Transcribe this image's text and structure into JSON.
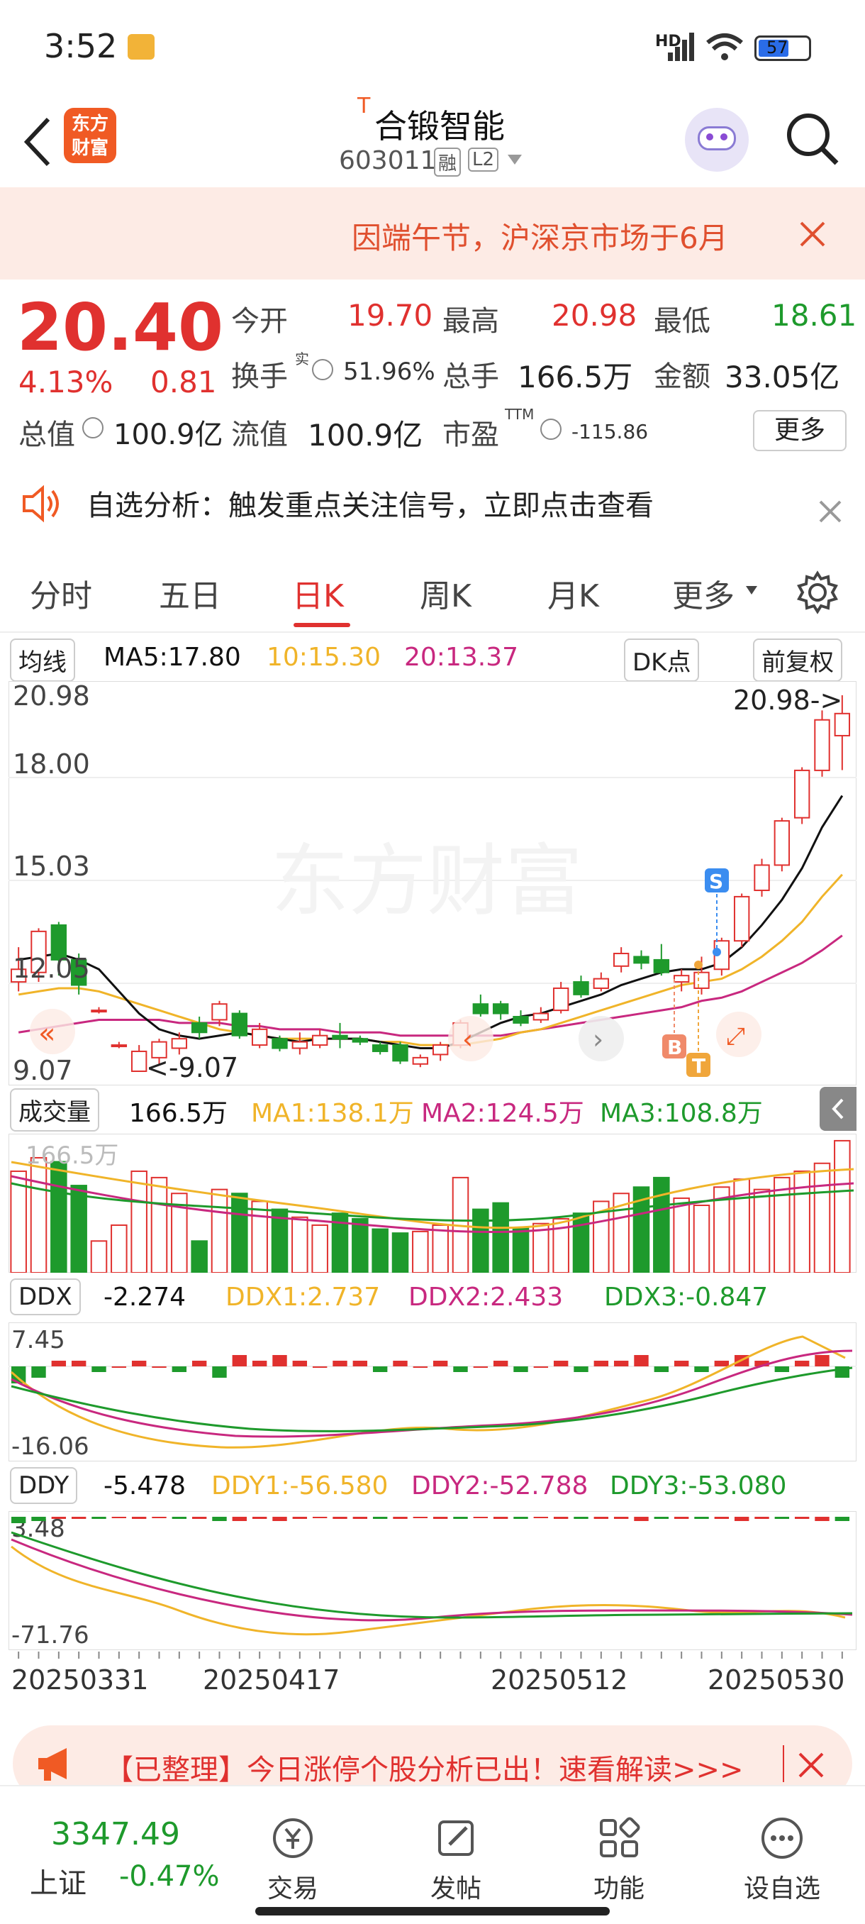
{
  "status_bar": {
    "time": "3:52",
    "battery": "57",
    "network": "HD"
  },
  "header": {
    "title": "合锻智能",
    "title_mark": "T",
    "code": "603011",
    "tag_margin": "融",
    "tag_level": "L2",
    "brand_logo": "东方\n财富"
  },
  "notice": {
    "text": "因端午节，沪深京市场于6月"
  },
  "quote": {
    "price": "20.40",
    "change_pct": "4.13%",
    "change_amt": "0.81",
    "open_label": "今开",
    "open": "19.70",
    "high_label": "最高",
    "high": "20.98",
    "low_label": "最低",
    "low": "18.61",
    "turnover_label": "换手",
    "turnover_sup": "实",
    "turnover": "51.96%",
    "volume_label": "总手",
    "volume": "166.5万",
    "amount_label": "金额",
    "amount": "33.05亿",
    "mktcap_label": "总值",
    "mktcap": "100.9亿",
    "float_label": "流值",
    "float": "100.9亿",
    "pe_label": "市盈",
    "pe_sup": "TTM",
    "pe": "-115.86",
    "more_label": "更多"
  },
  "analysis": {
    "text": "自选分析：触发重点关注信号，立即点击查看"
  },
  "tabs": [
    "分时",
    "五日",
    "日K",
    "周K",
    "月K",
    "更多"
  ],
  "active_tab": 2,
  "chart_header": {
    "ma_select": "均线",
    "ma5": "MA5:17.80",
    "ma10": "10:15.30",
    "ma20": "20:13.37",
    "dk": "DK点",
    "adjust": "前复权"
  },
  "price_axis": {
    "labels": [
      "20.98",
      "18.00",
      "15.03",
      "12.05",
      "9.07"
    ]
  },
  "price_annotations": {
    "max": "20.98->",
    "min": "<-9.07",
    "watermark": "东方财富",
    "s_marker": "S",
    "b_marker": "B",
    "t_marker": "T"
  },
  "volume_header": {
    "select": "成交量",
    "value": "166.5万",
    "ma1": "MA1:138.1万",
    "ma2": "MA2:124.5万",
    "ma3": "MA3:108.8万",
    "axis_label": "166.5万"
  },
  "ddx_header": {
    "select": "DDX",
    "value": "-2.274",
    "ddx1": "DDX1:2.737",
    "ddx2": "DDX2:2.433",
    "ddx3": "DDX3:-0.847",
    "axis_top": "7.45",
    "axis_bottom": "-16.06"
  },
  "ddy_header": {
    "select": "DDY",
    "value": "-5.478",
    "ddy1": "DDY1:-56.580",
    "ddy2": "DDY2:-52.788",
    "ddy3": "DDY3:-53.080",
    "axis_top": "3.48",
    "axis_bottom": "-71.76"
  },
  "date_axis": {
    "labels": [
      "20250331",
      "20250417",
      "20250512",
      "20250530"
    ]
  },
  "banner": {
    "text": "【已整理】今日涨停个股分析已出！速看解读>>>"
  },
  "bottom_nav": {
    "index_value": "3347.49",
    "index_name": "上证",
    "index_change": "-0.47%",
    "items": [
      "交易",
      "发帖",
      "功能",
      "设自选"
    ]
  },
  "colors": {
    "up": "#e0312f",
    "down": "#1e9a2c",
    "ma5": "#111111",
    "ma10": "#f0b429",
    "ma20": "#c8287f",
    "accent": "#f05a24"
  },
  "chart_data": {
    "type": "candlestick",
    "ylim": [
      9.07,
      20.98
    ],
    "candles": [
      {
        "o": 11.9,
        "c": 12.3,
        "h": 13.0,
        "l": 11.6
      },
      {
        "o": 12.2,
        "c": 13.5,
        "h": 13.6,
        "l": 11.9
      },
      {
        "o": 13.7,
        "c": 12.6,
        "h": 13.8,
        "l": 12.1
      },
      {
        "o": 12.6,
        "c": 11.8,
        "h": 12.8,
        "l": 11.5
      },
      {
        "o": 11.0,
        "c": 11.0,
        "h": 11.1,
        "l": 10.9
      },
      {
        "o": 9.9,
        "c": 9.9,
        "h": 10.0,
        "l": 9.8
      },
      {
        "o": 9.07,
        "c": 9.7,
        "h": 9.9,
        "l": 9.07
      },
      {
        "o": 9.5,
        "c": 10.0,
        "h": 10.1,
        "l": 9.3
      },
      {
        "o": 9.8,
        "c": 10.1,
        "h": 10.3,
        "l": 9.6
      },
      {
        "o": 10.6,
        "c": 10.3,
        "h": 10.8,
        "l": 10.1
      },
      {
        "o": 10.7,
        "c": 11.2,
        "h": 11.3,
        "l": 10.5
      },
      {
        "o": 10.9,
        "c": 10.2,
        "h": 11.0,
        "l": 10.1
      },
      {
        "o": 9.9,
        "c": 10.4,
        "h": 10.6,
        "l": 9.8
      },
      {
        "o": 10.1,
        "c": 9.8,
        "h": 10.2,
        "l": 9.7
      },
      {
        "o": 9.8,
        "c": 10.0,
        "h": 10.3,
        "l": 9.6
      },
      {
        "o": 9.9,
        "c": 10.2,
        "h": 10.4,
        "l": 9.8
      },
      {
        "o": 10.2,
        "c": 10.1,
        "h": 10.6,
        "l": 9.8
      },
      {
        "o": 10.1,
        "c": 10.0,
        "h": 10.2,
        "l": 9.9
      },
      {
        "o": 9.9,
        "c": 9.7,
        "h": 10.0,
        "l": 9.6
      },
      {
        "o": 9.9,
        "c": 9.4,
        "h": 10.0,
        "l": 9.3
      },
      {
        "o": 9.3,
        "c": 9.5,
        "h": 9.6,
        "l": 9.2
      },
      {
        "o": 9.6,
        "c": 9.9,
        "h": 10.0,
        "l": 9.4
      },
      {
        "o": 9.9,
        "c": 10.6,
        "h": 10.7,
        "l": 9.8
      },
      {
        "o": 11.2,
        "c": 10.9,
        "h": 11.5,
        "l": 10.8
      },
      {
        "o": 11.2,
        "c": 10.9,
        "h": 11.3,
        "l": 10.7
      },
      {
        "o": 10.8,
        "c": 10.6,
        "h": 11.0,
        "l": 10.5
      },
      {
        "o": 10.7,
        "c": 10.9,
        "h": 11.1,
        "l": 10.6
      },
      {
        "o": 11.0,
        "c": 11.7,
        "h": 11.9,
        "l": 10.9
      },
      {
        "o": 11.9,
        "c": 11.5,
        "h": 12.1,
        "l": 11.4
      },
      {
        "o": 11.7,
        "c": 12.0,
        "h": 12.2,
        "l": 11.6
      },
      {
        "o": 12.4,
        "c": 12.8,
        "h": 13.0,
        "l": 12.2
      },
      {
        "o": 12.7,
        "c": 12.5,
        "h": 12.9,
        "l": 12.3
      },
      {
        "o": 12.6,
        "c": 12.2,
        "h": 13.1,
        "l": 12.1
      },
      {
        "o": 11.9,
        "c": 12.1,
        "h": 12.3,
        "l": 11.6
      },
      {
        "o": 11.7,
        "c": 12.2,
        "h": 12.7,
        "l": 11.5
      },
      {
        "o": 12.3,
        "c": 13.2,
        "h": 13.3,
        "l": 12.1
      },
      {
        "o": 13.2,
        "c": 14.6,
        "h": 14.7,
        "l": 13.0
      },
      {
        "o": 14.8,
        "c": 15.6,
        "h": 15.8,
        "l": 14.6
      },
      {
        "o": 15.6,
        "c": 17.0,
        "h": 17.1,
        "l": 15.4
      },
      {
        "o": 17.1,
        "c": 18.6,
        "h": 18.7,
        "l": 16.9
      },
      {
        "o": 18.6,
        "c": 20.2,
        "h": 20.5,
        "l": 18.4
      },
      {
        "o": 19.7,
        "c": 20.4,
        "h": 20.98,
        "l": 18.61
      }
    ],
    "ma5": [
      12.6,
      12.7,
      12.8,
      12.6,
      12.3,
      11.6,
      10.9,
      10.4,
      10.2,
      10.1,
      10.2,
      10.3,
      10.2,
      10.1,
      10.0,
      10.1,
      10.1,
      10.1,
      10.0,
      9.9,
      9.8,
      9.8,
      10.0,
      10.3,
      10.6,
      10.8,
      10.9,
      11.1,
      11.3,
      11.5,
      11.8,
      12.0,
      12.2,
      12.3,
      12.3,
      12.5,
      13.0,
      13.7,
      14.5,
      15.5,
      16.8,
      17.8
    ],
    "ma10": [
      11.5,
      11.6,
      11.7,
      11.7,
      11.6,
      11.4,
      11.2,
      11.0,
      10.8,
      10.6,
      10.4,
      10.3,
      10.2,
      10.1,
      10.1,
      10.1,
      10.1,
      10.1,
      10.0,
      10.0,
      9.9,
      9.9,
      9.9,
      10.0,
      10.1,
      10.3,
      10.4,
      10.6,
      10.8,
      11.0,
      11.2,
      11.4,
      11.6,
      11.8,
      11.9,
      12.0,
      12.3,
      12.7,
      13.2,
      13.8,
      14.6,
      15.3
    ],
    "ma20": [
      10.3,
      10.4,
      10.5,
      10.6,
      10.7,
      10.7,
      10.7,
      10.7,
      10.6,
      10.6,
      10.6,
      10.5,
      10.5,
      10.4,
      10.4,
      10.4,
      10.3,
      10.3,
      10.3,
      10.2,
      10.2,
      10.2,
      10.2,
      10.2,
      10.2,
      10.3,
      10.4,
      10.5,
      10.6,
      10.7,
      10.8,
      10.9,
      11.0,
      11.1,
      11.3,
      11.4,
      11.6,
      11.9,
      12.2,
      12.5,
      12.9,
      13.37
    ],
    "volume": [
      128,
      145,
      140,
      110,
      40,
      60,
      128,
      120,
      100,
      40,
      105,
      100,
      90,
      80,
      70,
      60,
      75,
      68,
      55,
      50,
      52,
      60,
      120,
      80,
      88,
      56,
      62,
      68,
      75,
      90,
      100,
      108,
      120,
      94,
      85,
      108,
      118,
      105,
      120,
      128,
      138,
      166.5
    ]
  }
}
